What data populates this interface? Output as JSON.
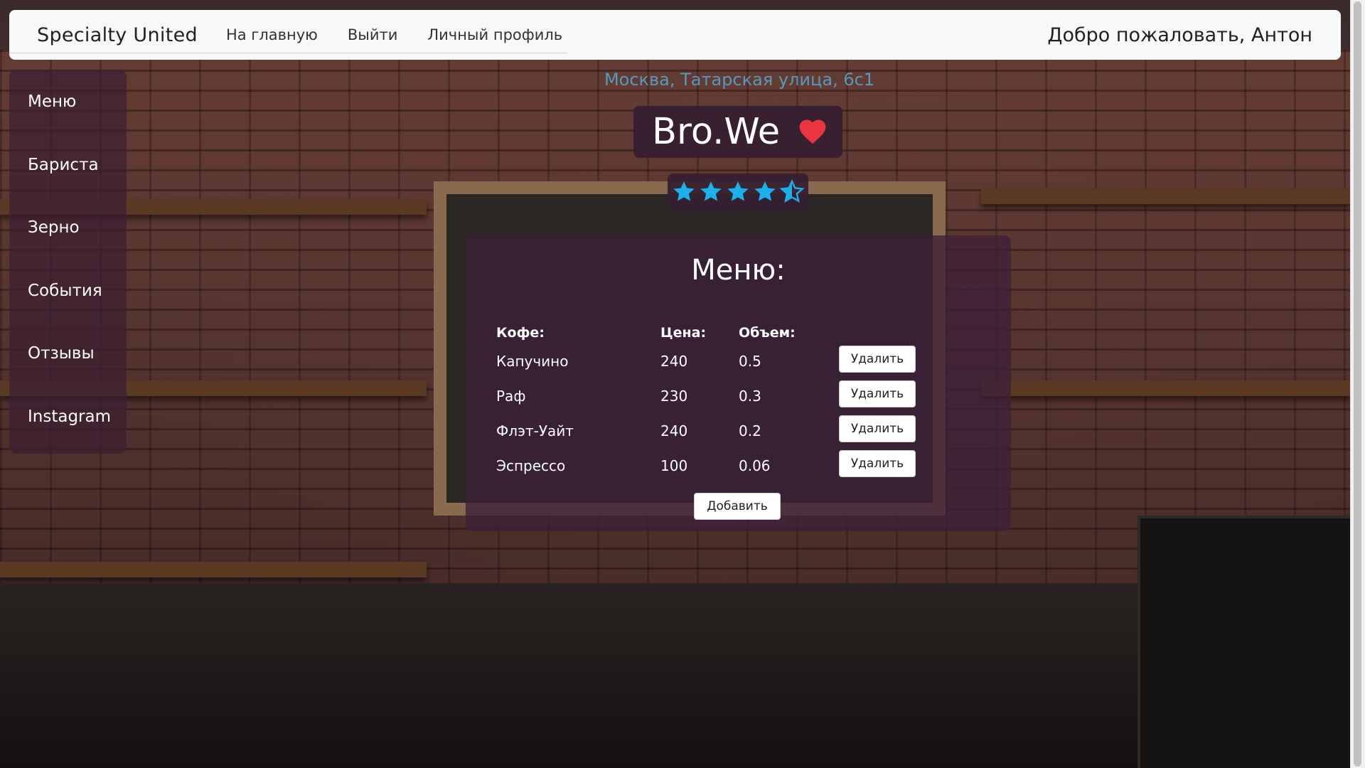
{
  "navbar": {
    "brand": "Specialty United",
    "links": [
      "На главную",
      "Выйти",
      "Личный профиль"
    ],
    "welcome": "Добро пожаловать, Антон"
  },
  "sidebar": {
    "items": [
      "Меню",
      "Бариста",
      "Зерно",
      "События",
      "Отзывы",
      "Instagram"
    ]
  },
  "shop": {
    "address": "Москва, Татарская улица, 6с1",
    "name": "Bro.We",
    "favorite_icon": "heart-icon",
    "favorite_color": "#e8353f",
    "rating": 4.5,
    "rating_max": 5,
    "star_color": "#1ab0e8"
  },
  "menu": {
    "title": "Меню:",
    "headers": {
      "name": "Кофе:",
      "price": "Цена:",
      "volume": "Объем:"
    },
    "rows": [
      {
        "name": "Капучино",
        "price": "240",
        "volume": "0.5",
        "delete_label": "Удалить"
      },
      {
        "name": "Раф",
        "price": "230",
        "volume": "0.3",
        "delete_label": "Удалить"
      },
      {
        "name": "Флэт-Уайт",
        "price": "240",
        "volume": "0.2",
        "delete_label": "Удалить"
      },
      {
        "name": "Эспрессо",
        "price": "100",
        "volume": "0.06",
        "delete_label": "Удалить"
      }
    ],
    "add_label": "Добавить"
  }
}
